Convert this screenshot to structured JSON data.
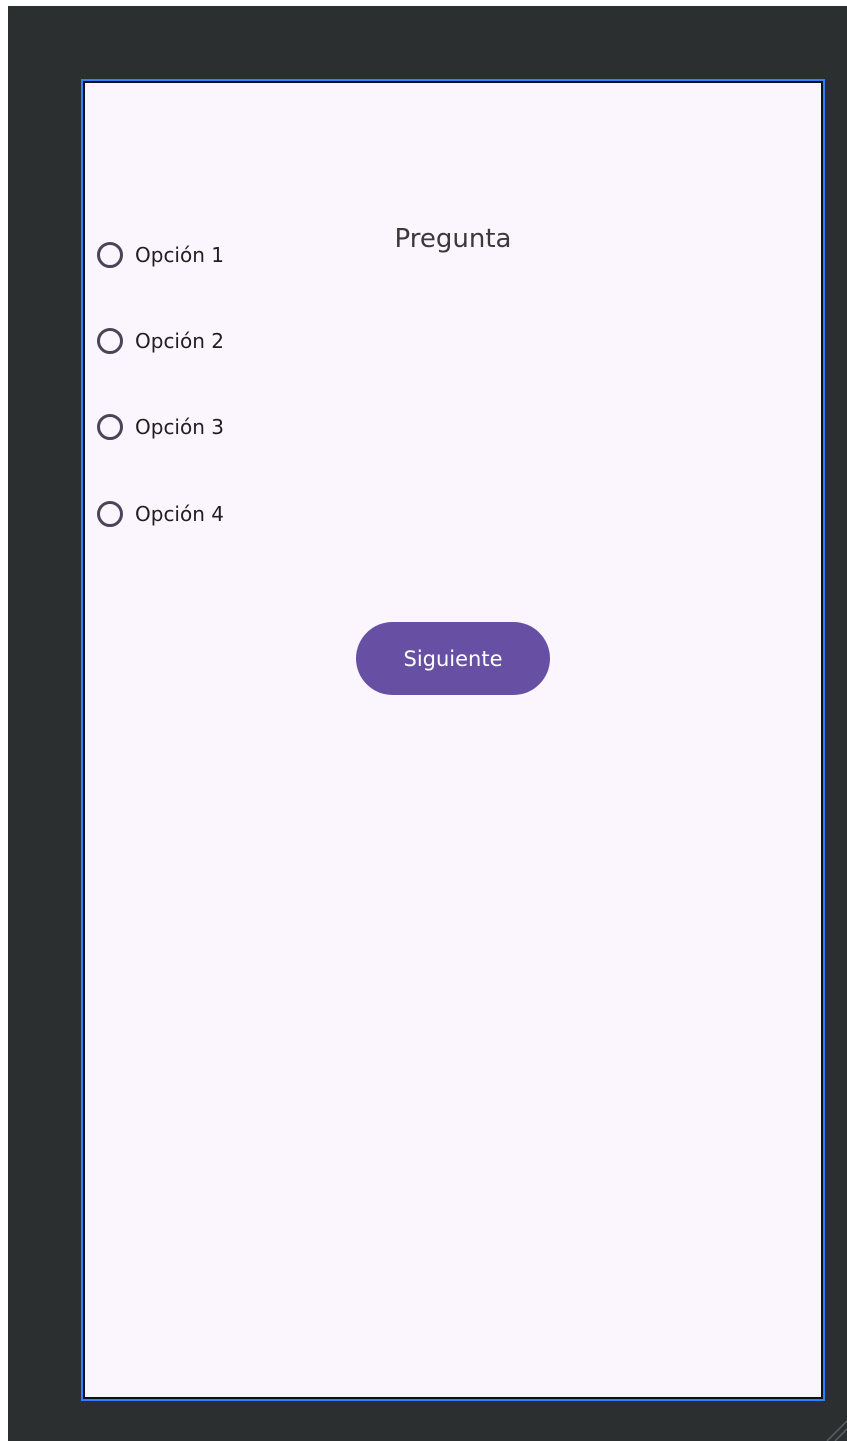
{
  "screen": {
    "title": "Pregunta",
    "options": [
      {
        "label": "Opción 1"
      },
      {
        "label": "Opción 2"
      },
      {
        "label": "Opción 3"
      },
      {
        "label": "Opción 4"
      }
    ],
    "next_button": {
      "label": "Siguiente"
    }
  },
  "colors": {
    "editor_background": "#2b2f30",
    "device_border": "#2f80ff",
    "screen_background": "#fbf5fe",
    "radio_outline": "#4a4458",
    "button_background": "#6750a4",
    "button_text": "#ffffff",
    "text_primary": "#1f1f1f"
  },
  "icons": {
    "radio": "radio-unchecked-icon",
    "grip": "resize-grip-icon"
  }
}
